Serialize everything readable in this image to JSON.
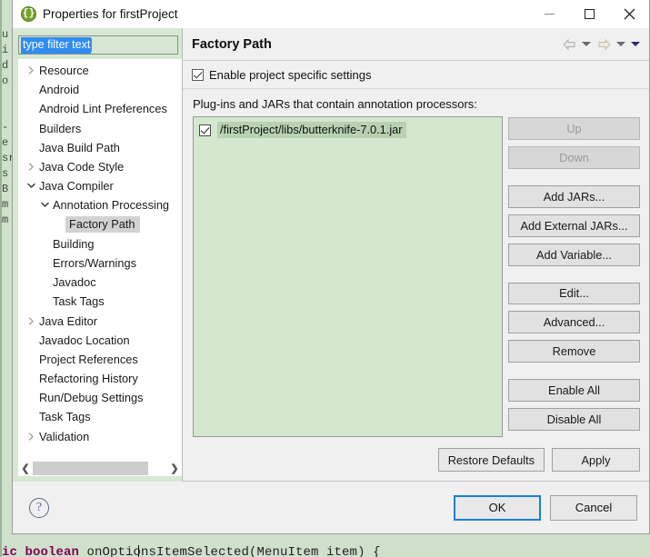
{
  "window": {
    "title": "Properties for firstProject",
    "icon": "braces-icon",
    "minimize_label": "Minimize",
    "maximize_label": "Maximize",
    "close_label": "Close"
  },
  "sidebar": {
    "filter": {
      "value": "type filter text",
      "placeholder": "type filter text"
    },
    "scroll_left_label": "❮",
    "scroll_right_label": "❯",
    "items": [
      {
        "label": "Resource",
        "indent": 0,
        "twisty": "collapsed",
        "selected": false
      },
      {
        "label": "Android",
        "indent": 0,
        "twisty": "none",
        "selected": false
      },
      {
        "label": "Android Lint Preferences",
        "indent": 0,
        "twisty": "none",
        "selected": false
      },
      {
        "label": "Builders",
        "indent": 0,
        "twisty": "none",
        "selected": false
      },
      {
        "label": "Java Build Path",
        "indent": 0,
        "twisty": "none",
        "selected": false
      },
      {
        "label": "Java Code Style",
        "indent": 0,
        "twisty": "collapsed",
        "selected": false
      },
      {
        "label": "Java Compiler",
        "indent": 0,
        "twisty": "expanded",
        "selected": false
      },
      {
        "label": "Annotation Processing",
        "indent": 1,
        "twisty": "expanded",
        "selected": false
      },
      {
        "label": "Factory Path",
        "indent": 2,
        "twisty": "none",
        "selected": true
      },
      {
        "label": "Building",
        "indent": 1,
        "twisty": "none",
        "selected": false
      },
      {
        "label": "Errors/Warnings",
        "indent": 1,
        "twisty": "none",
        "selected": false
      },
      {
        "label": "Javadoc",
        "indent": 1,
        "twisty": "none",
        "selected": false
      },
      {
        "label": "Task Tags",
        "indent": 1,
        "twisty": "none",
        "selected": false
      },
      {
        "label": "Java Editor",
        "indent": 0,
        "twisty": "collapsed",
        "selected": false
      },
      {
        "label": "Javadoc Location",
        "indent": 0,
        "twisty": "none",
        "selected": false
      },
      {
        "label": "Project References",
        "indent": 0,
        "twisty": "none",
        "selected": false
      },
      {
        "label": "Refactoring History",
        "indent": 0,
        "twisty": "none",
        "selected": false
      },
      {
        "label": "Run/Debug Settings",
        "indent": 0,
        "twisty": "none",
        "selected": false
      },
      {
        "label": "Task Tags",
        "indent": 0,
        "twisty": "none",
        "selected": false
      },
      {
        "label": "Validation",
        "indent": 0,
        "twisty": "collapsed",
        "selected": false
      }
    ]
  },
  "page": {
    "title": "Factory Path",
    "nav": {
      "back_icon": "arrow-left-icon",
      "back_menu_icon": "chevron-down-icon",
      "forward_icon": "arrow-right-icon",
      "forward_menu_icon": "chevron-down-icon",
      "more_menu_icon": "chevron-down-icon"
    },
    "enable_specific": {
      "label": "Enable project specific settings",
      "checked": true
    },
    "list_label": "Plug-ins and JARs that contain annotation processors:",
    "jars": [
      {
        "name": "/firstProject/libs/butterknife-7.0.1.jar",
        "checked": true,
        "selected": true
      }
    ],
    "buttons": [
      {
        "label": "Up",
        "disabled": true,
        "gap_after": false
      },
      {
        "label": "Down",
        "disabled": true,
        "gap_after": true
      },
      {
        "label": "Add JARs...",
        "disabled": false,
        "gap_after": false
      },
      {
        "label": "Add External JARs...",
        "disabled": false,
        "gap_after": false
      },
      {
        "label": "Add Variable...",
        "disabled": false,
        "gap_after": true
      },
      {
        "label": "Edit...",
        "disabled": false,
        "gap_after": false
      },
      {
        "label": "Advanced...",
        "disabled": false,
        "gap_after": false
      },
      {
        "label": "Remove",
        "disabled": false,
        "gap_after": true
      },
      {
        "label": "Enable All",
        "disabled": false,
        "gap_after": false
      },
      {
        "label": "Disable All",
        "disabled": false,
        "gap_after": false
      }
    ],
    "restore_defaults_label": "Restore Defaults",
    "apply_label": "Apply"
  },
  "footer": {
    "help_icon": "question-mark-icon",
    "help_label": "?",
    "ok_label": "OK",
    "cancel_label": "Cancel"
  },
  "backdrop": {
    "left_column_text": "u\ni\nd\no\n\n\n-\ne\nsr\ns\nB\nm\nm",
    "bottom_code_prefix": "ic boolean ",
    "bottom_code_rest": "onOptionsItemSelected(MenuItem item) {"
  }
}
